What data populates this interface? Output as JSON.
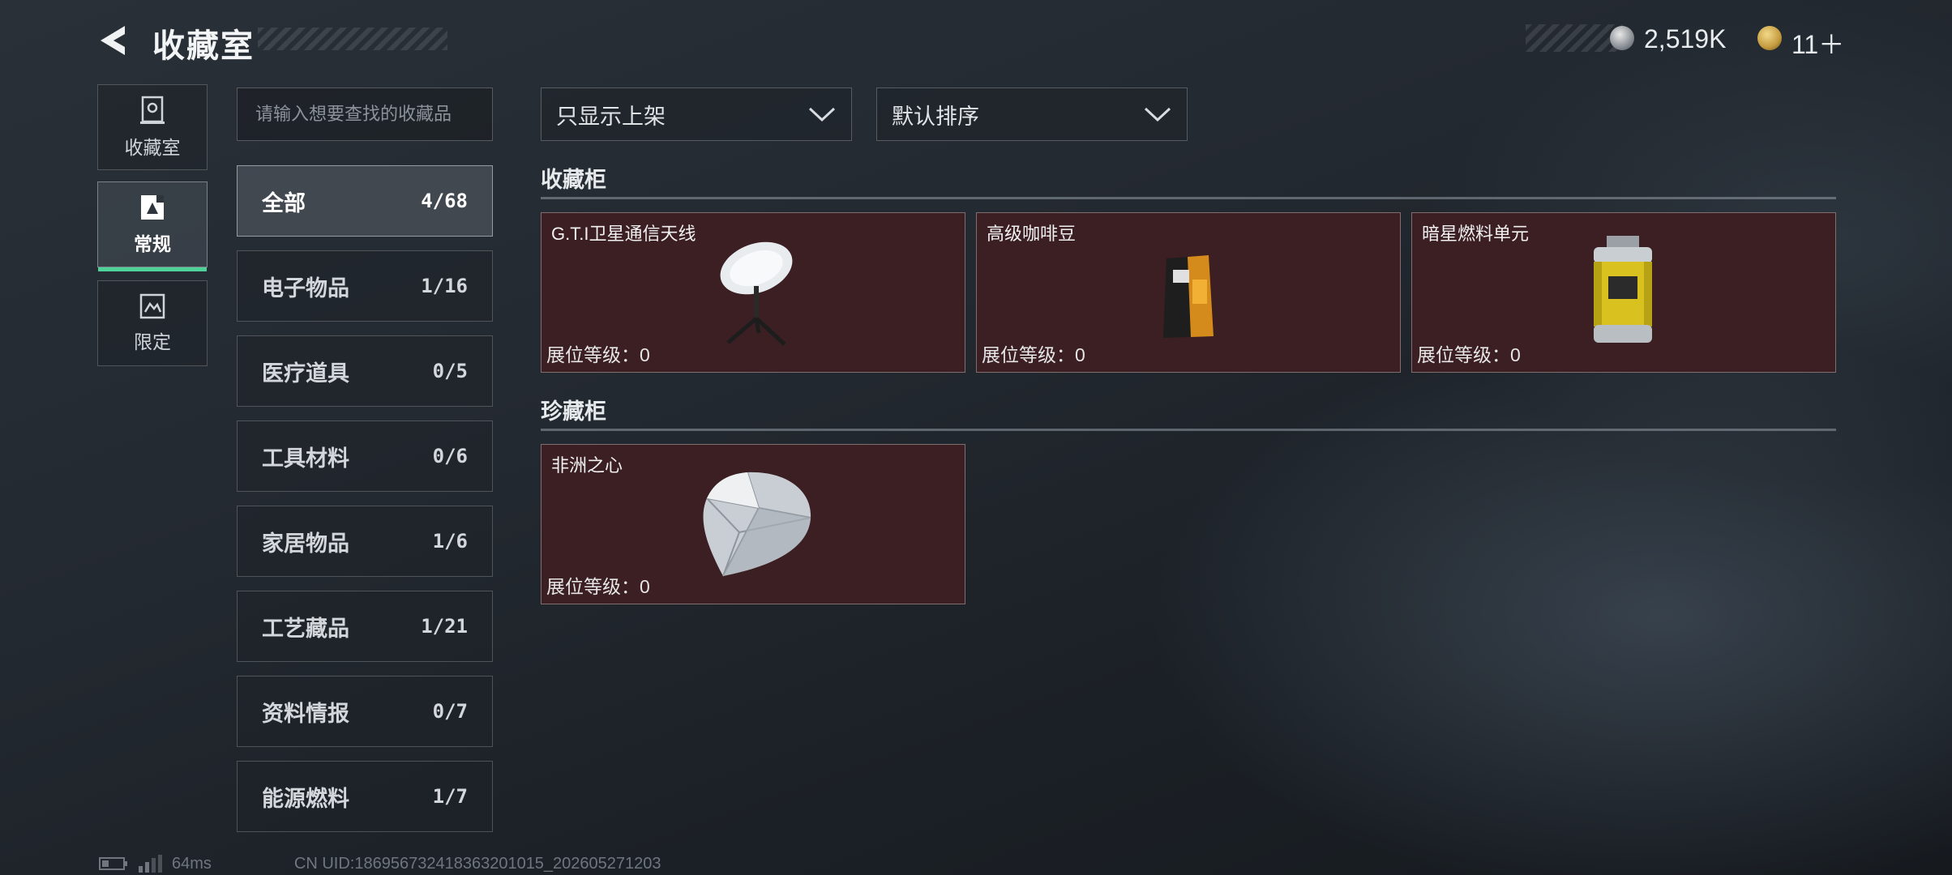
{
  "header": {
    "title": "收藏室",
    "currency": [
      {
        "icon": "silver-coin-icon",
        "value": "2,519K"
      },
      {
        "icon": "gold-coin-icon",
        "value": "11＋"
      }
    ]
  },
  "side_tabs": [
    {
      "label": "收藏室",
      "icon": "collection-room-icon",
      "active": false
    },
    {
      "label": "常规",
      "icon": "regular-icon",
      "active": true
    },
    {
      "label": "限定",
      "icon": "limited-icon",
      "active": false
    }
  ],
  "search": {
    "placeholder": "请输入想要查找的收藏品",
    "value": ""
  },
  "categories": [
    {
      "name": "全部",
      "count": "4/68",
      "active": true
    },
    {
      "name": "电子物品",
      "count": "1/16"
    },
    {
      "name": "医疗道具",
      "count": "0/5"
    },
    {
      "name": "工具材料",
      "count": "0/6"
    },
    {
      "name": "家居物品",
      "count": "1/6"
    },
    {
      "name": "工艺藏品",
      "count": "1/21"
    },
    {
      "name": "资料情报",
      "count": "0/7"
    },
    {
      "name": "能源燃料",
      "count": "1/7"
    }
  ],
  "filters": {
    "display": {
      "value": "只显示上架"
    },
    "sort": {
      "value": "默认排序"
    }
  },
  "sections": [
    {
      "title": "收藏柜",
      "items": [
        {
          "name": "G.T.I卫星通信天线",
          "level_label": "展位等级：0",
          "icon": "satellite-dish-icon"
        },
        {
          "name": "高级咖啡豆",
          "level_label": "展位等级：0",
          "icon": "coffee-bag-icon"
        },
        {
          "name": "暗星燃料单元",
          "level_label": "展位等级：0",
          "icon": "fuel-canister-icon"
        }
      ]
    },
    {
      "title": "珍藏柜",
      "items": [
        {
          "name": "非洲之心",
          "level_label": "展位等级：0",
          "icon": "diamond-icon"
        }
      ]
    }
  ],
  "footer": {
    "ping": "64ms",
    "uid": "CN UID:186956732418363201015_202605271203"
  },
  "colors": {
    "accent": "#4fd29a",
    "card_bg": "#3b1f23",
    "background": "#1f252b"
  }
}
